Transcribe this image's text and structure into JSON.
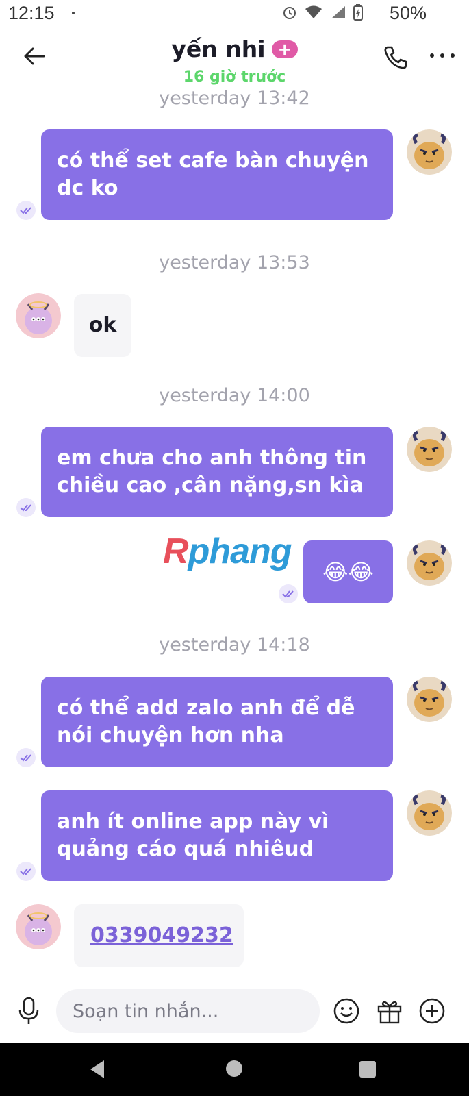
{
  "status_bar": {
    "time": "12:15",
    "battery": "50%"
  },
  "header": {
    "contact_name": "yến nhi",
    "badge": "+",
    "last_seen": "16 giờ trước"
  },
  "messages": {
    "ts1": "yesterday 13:42",
    "m1": "có thể set cafe bàn chuyện dc ko",
    "ts2": "yesterday 13:53",
    "m2": "ok",
    "ts3": "yesterday 14:00",
    "m3": "em chưa cho anh thông tin chiều cao ,cân nặng,sn kìa",
    "m4": "😂😂",
    "ts4": "yesterday 14:18",
    "m5": "có thể add zalo anh để dễ nói chuyện hơn nha",
    "m6": "anh ít online app này vì quảng cáo quá nhiêud",
    "m7": "0339049232"
  },
  "watermark": {
    "first": "R",
    "rest": "phang"
  },
  "composer": {
    "placeholder": "Soạn tin nhắn..."
  },
  "colors": {
    "outgoing_bubble": "#8870e6",
    "incoming_bubble": "#f5f5f7",
    "online_green": "#5cd66b",
    "timestamp_gray": "#a3a3ad"
  }
}
